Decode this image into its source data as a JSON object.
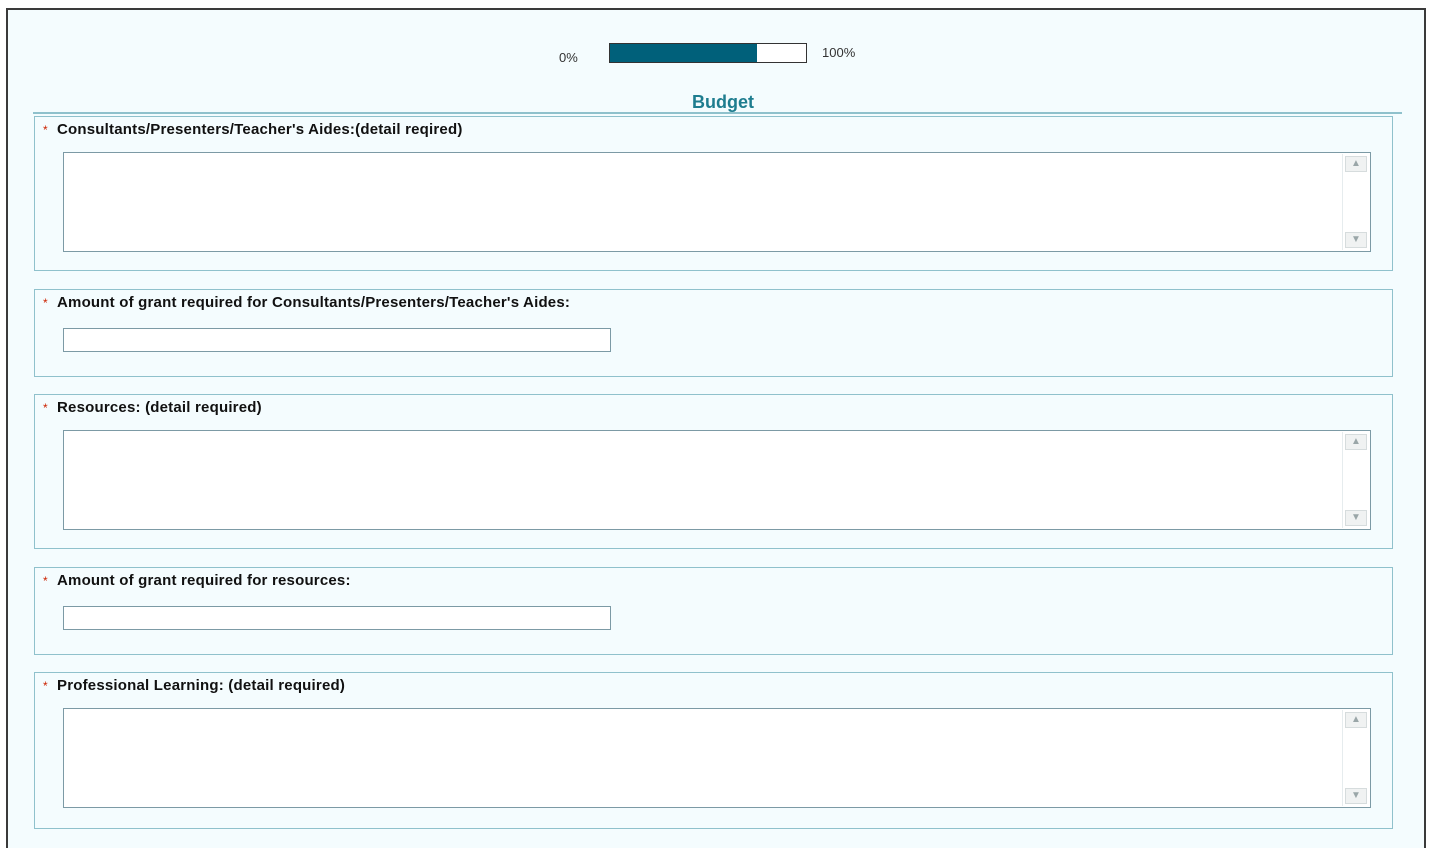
{
  "progress": {
    "min_label": "0%",
    "max_label": "100%",
    "fraction": 0.75
  },
  "section": {
    "title": "Budget"
  },
  "fields": [
    {
      "label": "Consultants/Presenters/Teacher's Aides:(detail reqired)",
      "required_mark": "*",
      "type": "textarea",
      "value": ""
    },
    {
      "label": "Amount of grant required for Consultants/Presenters/Teacher's Aides:",
      "required_mark": "*",
      "type": "text",
      "value": ""
    },
    {
      "label": "Resources: (detail required)",
      "required_mark": "*",
      "type": "textarea",
      "value": ""
    },
    {
      "label": "Amount of grant required for resources:",
      "required_mark": "*",
      "type": "text",
      "value": ""
    },
    {
      "label": "Professional Learning: (detail required)",
      "required_mark": "*",
      "type": "textarea",
      "value": ""
    }
  ],
  "icons": {
    "scroll_up": "chevron-up-icon",
    "scroll_down": "chevron-down-icon"
  },
  "colors": {
    "progress_fill": "#00607a",
    "section_title": "#1e7d8f",
    "required_mark": "#cc2200",
    "border": "#8fc1cc"
  }
}
